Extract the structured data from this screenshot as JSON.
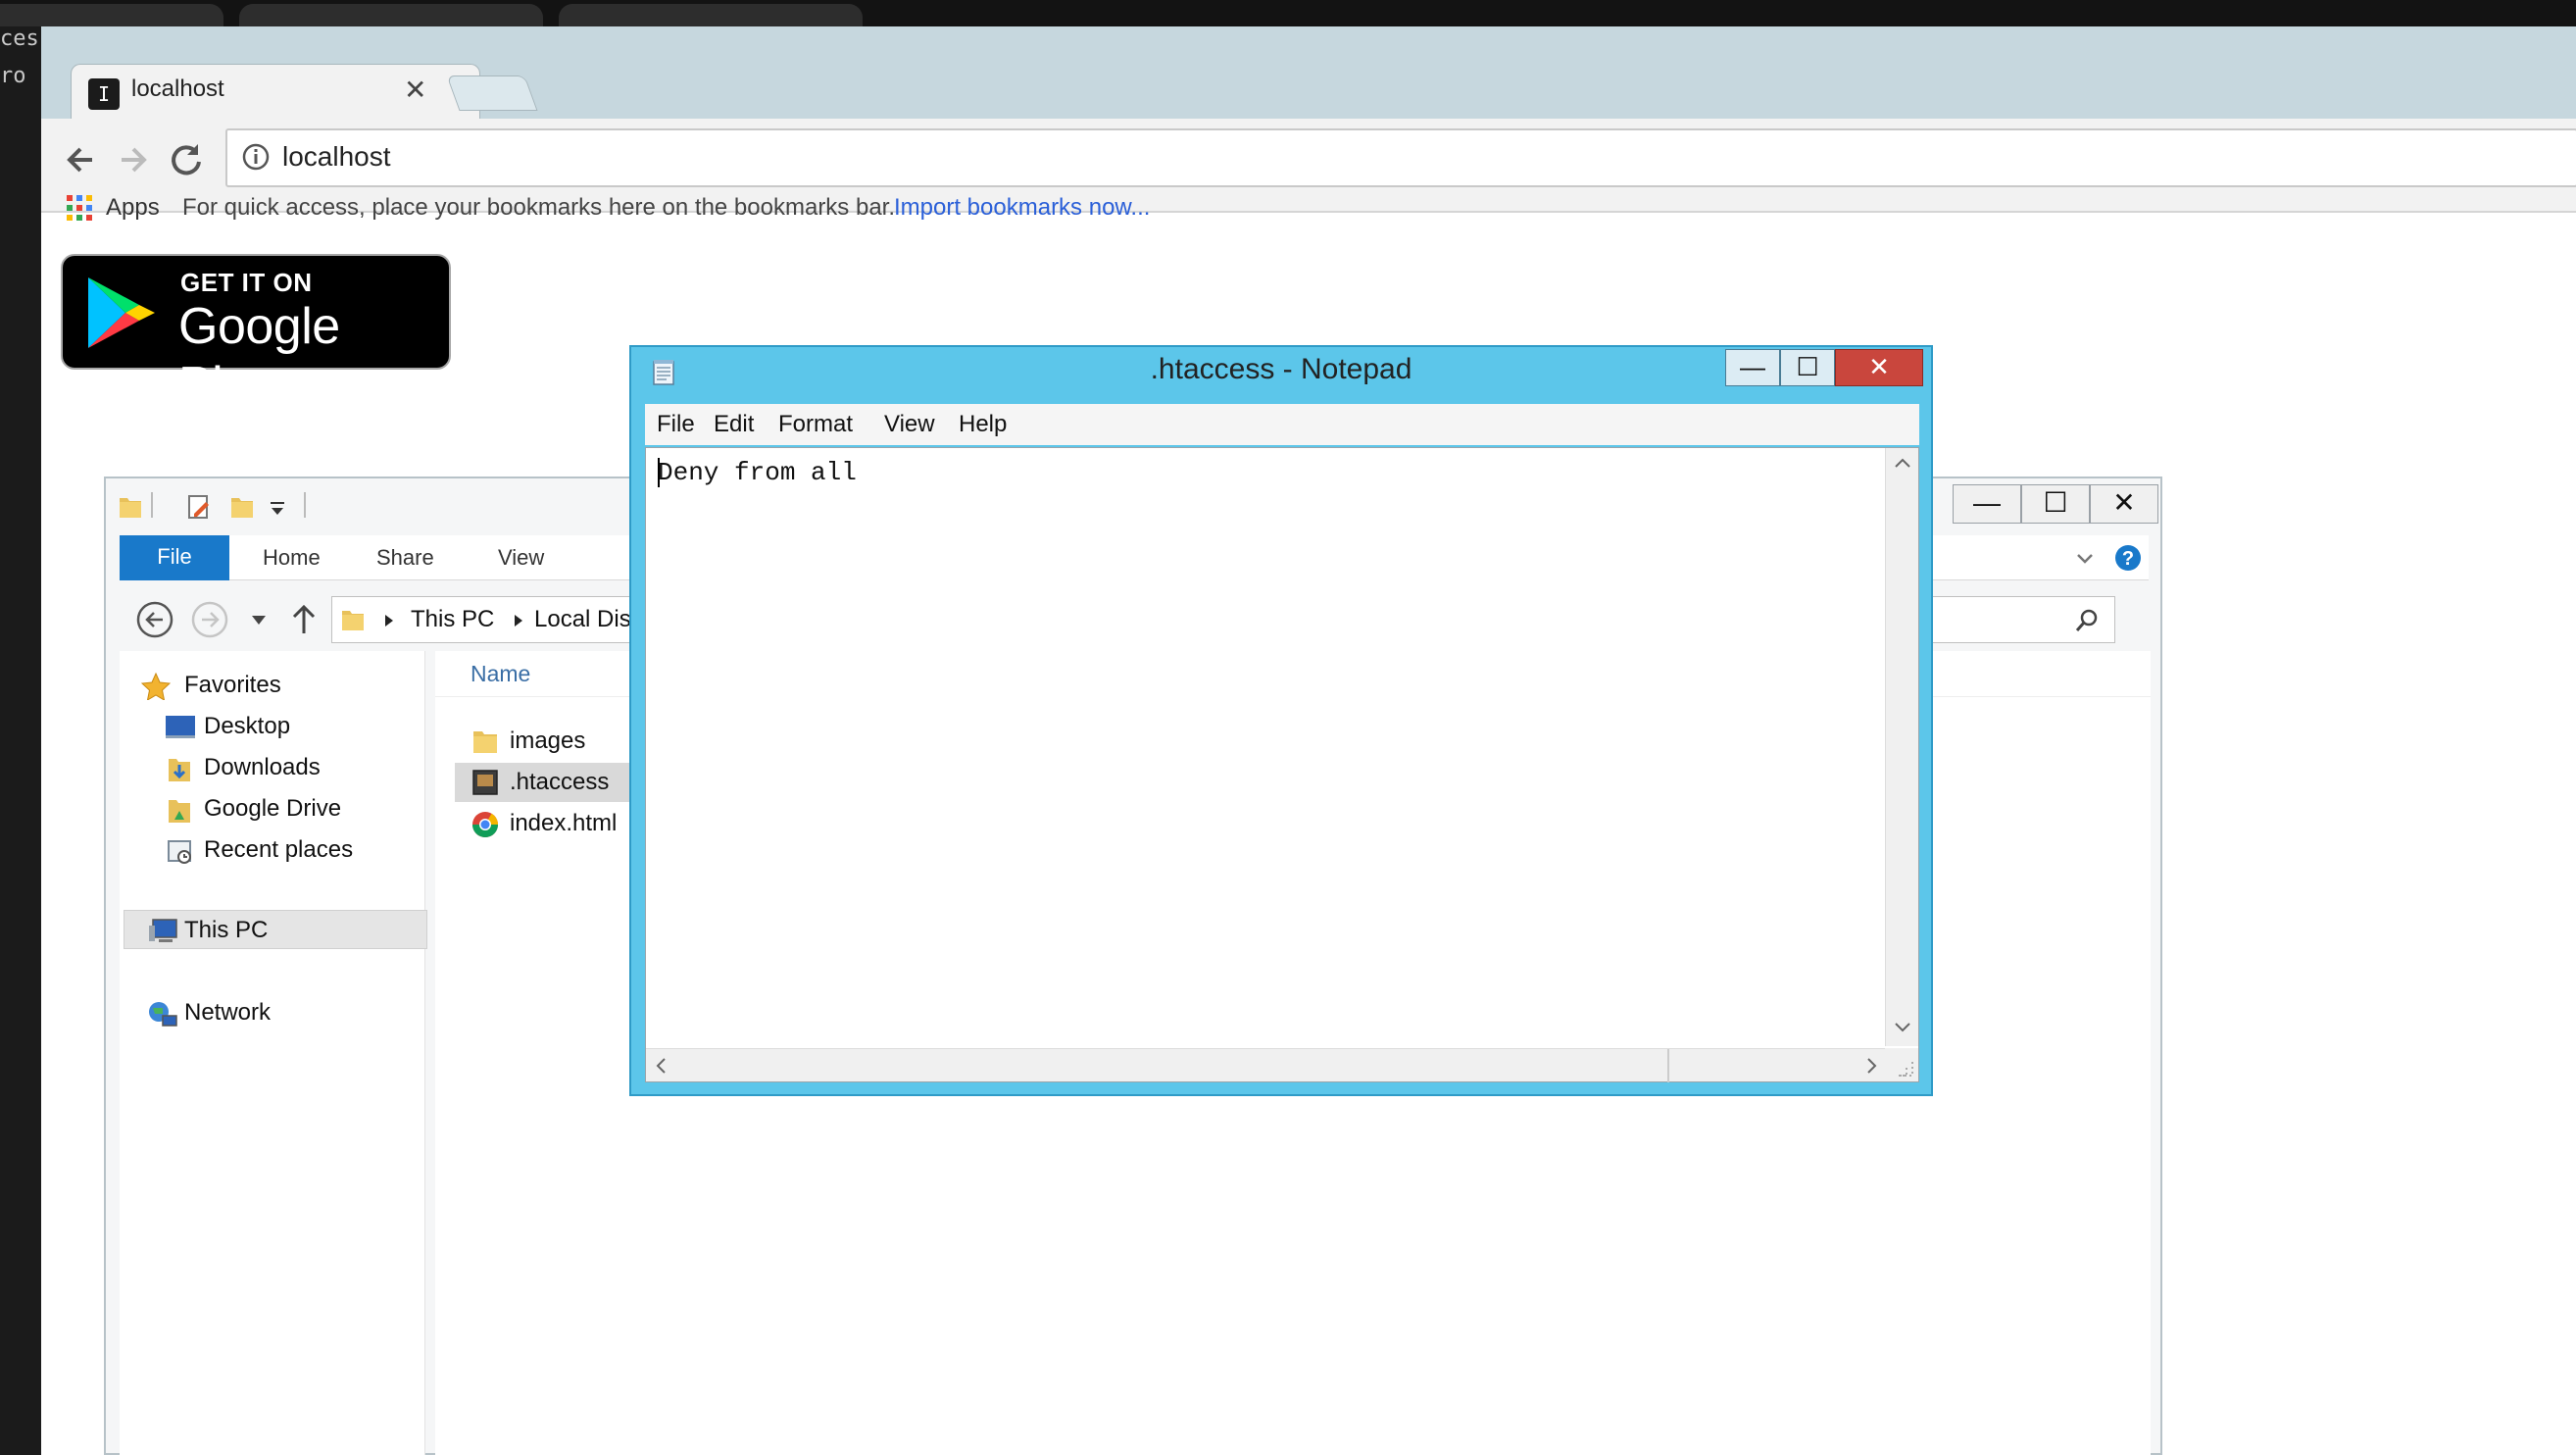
{
  "left_strip": {
    "fragment_1": "cess",
    "fragment_2": "ro"
  },
  "browser": {
    "tab": {
      "title": "localhost",
      "favicon_char": "I",
      "close_glyph": "✕"
    },
    "address": {
      "url": "localhost"
    },
    "bookmarks": {
      "apps_label": "Apps",
      "hint": "For quick access, place your bookmarks here on the bookmarks bar.",
      "import_link": "Import bookmarks now..."
    },
    "page": {
      "badge_small": "GET IT ON",
      "badge_big": "Google Play"
    }
  },
  "explorer": {
    "window_controls": {
      "minimize": "—",
      "maximize": "☐",
      "close": "✕"
    },
    "ribbon_tabs": [
      "File",
      "Home",
      "Share",
      "View"
    ],
    "address_path": [
      "This PC",
      "Local Disk"
    ],
    "nav": {
      "favorites": "Favorites",
      "desktop": "Desktop",
      "downloads": "Downloads",
      "google_drive": "Google Drive",
      "recent_places": "Recent places",
      "this_pc": "This PC",
      "network": "Network"
    },
    "column_name": "Name",
    "files": [
      "images",
      ".htaccess",
      "index.html"
    ]
  },
  "notepad": {
    "title": ".htaccess - Notepad",
    "menu": [
      "File",
      "Edit",
      "Format",
      "View",
      "Help"
    ],
    "content": "Deny from all",
    "controls": {
      "minimize": "—",
      "maximize": "☐",
      "close": "✕"
    }
  },
  "colors": {
    "notepad_frame": "#5cc6ea",
    "ribbon_file": "#1979ca",
    "link": "#2a5fd8",
    "tabbar": "#c6d7de"
  }
}
